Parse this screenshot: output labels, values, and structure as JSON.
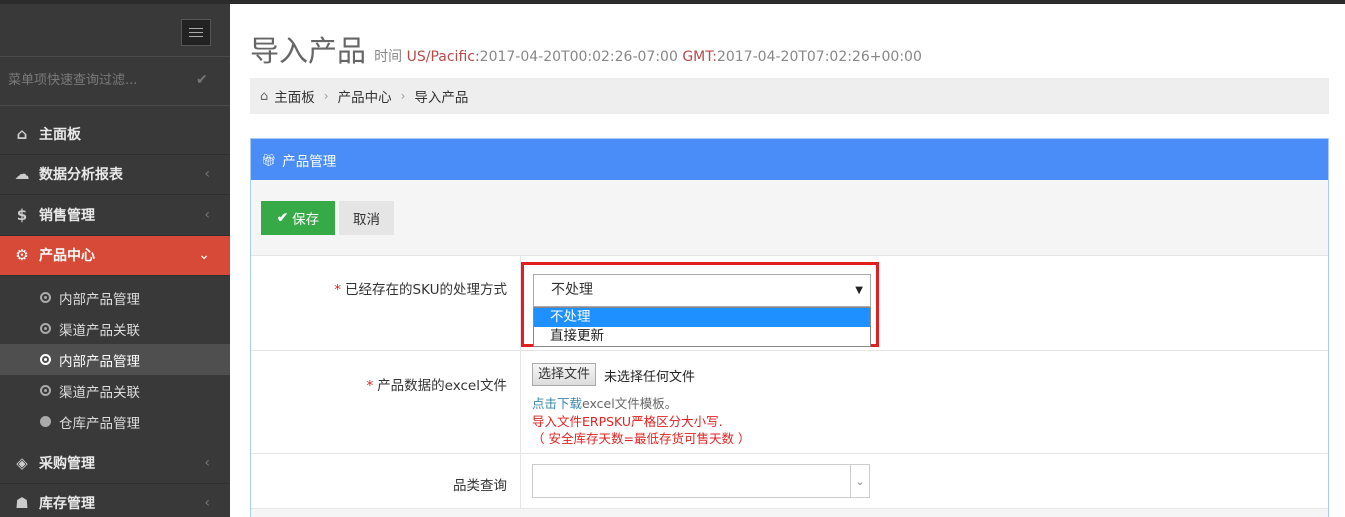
{
  "sidebar": {
    "search_placeholder": "菜单项快速查询过滤...",
    "menu": [
      {
        "label": "主面板",
        "icon": "home-icon"
      },
      {
        "label": "数据分析报表",
        "icon": "cloud-icon"
      },
      {
        "label": "销售管理",
        "icon": "dollar-icon"
      },
      {
        "label": "产品中心",
        "icon": "gears-icon"
      },
      {
        "label": "采购管理",
        "icon": "cube-icon"
      },
      {
        "label": "库存管理",
        "icon": "android-icon"
      }
    ],
    "submenu": [
      {
        "label": "内部产品管理"
      },
      {
        "label": "渠道产品关联"
      },
      {
        "label": "内部产品管理"
      },
      {
        "label": "渠道产品关联"
      },
      {
        "label": "仓库产品管理"
      }
    ]
  },
  "header": {
    "title": "导入产品",
    "time_label": "时间",
    "tz1_label": "US/Pacific:",
    "tz1_value": "2017-04-20T00:02:26-07:00",
    "tz2_label": "GMT:",
    "tz2_value": "2017-04-20T07:02:26+00:00"
  },
  "breadcrumb": [
    "主面板",
    "产品中心",
    "导入产品"
  ],
  "portlet": {
    "title": "产品管理",
    "save_label": "保存",
    "cancel_label": "取消"
  },
  "form": {
    "sku_label": "已经存在的SKU的处理方式",
    "sku_value": "不处理",
    "sku_options": [
      "不处理",
      "直接更新"
    ],
    "file_label": "产品数据的excel文件",
    "file_button": "选择文件",
    "file_status": "未选择任何文件",
    "help_link": "点击下载",
    "help_text": "excel文件模板。",
    "help_warn1": "导入文件ERPSKU严格区分大小写.",
    "help_warn2": "（ 安全库存天数=最低存货可售天数 ）",
    "category_label": "品类查询",
    "category_value": ""
  },
  "colors": {
    "accent_red": "#d84a38",
    "header_blue": "#4b8df8",
    "save_green": "#35aa47",
    "highlight_box": "#e02020"
  }
}
